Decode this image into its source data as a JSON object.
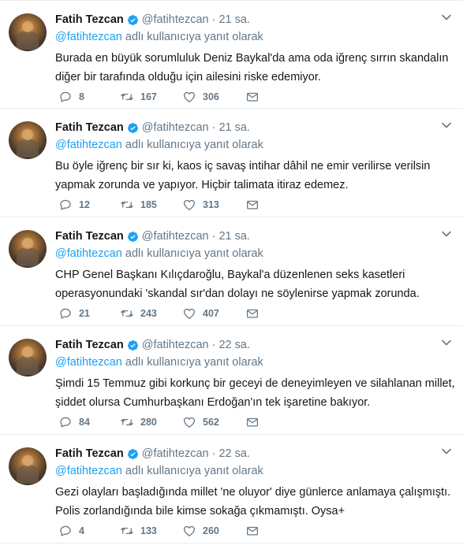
{
  "colors": {
    "link": "#1da1f2",
    "secondary": "#657786",
    "text": "#14171a",
    "border": "#e6ecf0"
  },
  "tweets": [
    {
      "name": "Fatih Tezcan",
      "handle": "@fatihtezcan",
      "time": "21 sa.",
      "reply_mention": "@fatihtezcan",
      "reply_suffix": "adlı kullanıcıya yanıt olarak",
      "text_lines": [
        "Burada en büyük sorumluluk Deniz Baykal'da ama oda iğrenç sırrın skandalın",
        "diğer bir tarafında olduğu için ailesini riske edemiyor."
      ],
      "replies": "8",
      "retweets": "167",
      "likes": "306"
    },
    {
      "name": "Fatih Tezcan",
      "handle": "@fatihtezcan",
      "time": "21 sa.",
      "reply_mention": "@fatihtezcan",
      "reply_suffix": "adlı kullanıcıya yanıt olarak",
      "text_lines": [
        "Bu öyle iğrenç bir sır ki, kaos iç savaş intihar dâhil ne emir verilirse verilsin",
        "yapmak zorunda ve yapıyor. Hiçbir talimata itiraz edemez."
      ],
      "replies": "12",
      "retweets": "185",
      "likes": "313"
    },
    {
      "name": "Fatih Tezcan",
      "handle": "@fatihtezcan",
      "time": "21 sa.",
      "reply_mention": "@fatihtezcan",
      "reply_suffix": "adlı kullanıcıya yanıt olarak",
      "text_lines": [
        "CHP Genel Başkanı Kılıçdaroğlu, Baykal'a düzenlenen seks kasetleri",
        "operasyonundaki 'skandal sır'dan dolayı ne söylenirse yapmak zorunda."
      ],
      "replies": "21",
      "retweets": "243",
      "likes": "407"
    },
    {
      "name": "Fatih Tezcan",
      "handle": "@fatihtezcan",
      "time": "22 sa.",
      "reply_mention": "@fatihtezcan",
      "reply_suffix": "adlı kullanıcıya yanıt olarak",
      "text_lines": [
        "Şimdi 15 Temmuz gibi korkunç bir geceyi de deneyimleyen ve silahlanan millet,",
        "şiddet olursa Cumhurbaşkanı Erdoğan'ın tek işaretine bakıyor."
      ],
      "replies": "84",
      "retweets": "280",
      "likes": "562"
    },
    {
      "name": "Fatih Tezcan",
      "handle": "@fatihtezcan",
      "time": "22 sa.",
      "reply_mention": "@fatihtezcan",
      "reply_suffix": "adlı kullanıcıya yanıt olarak",
      "text_lines": [
        "Gezi olayları başladığında millet 'ne oluyor' diye günlerce anlamaya çalışmıştı.",
        "Polis zorlandığında bile kimse sokağa çıkmamıştı. Oysa+"
      ],
      "replies": "4",
      "retweets": "133",
      "likes": "260"
    }
  ]
}
